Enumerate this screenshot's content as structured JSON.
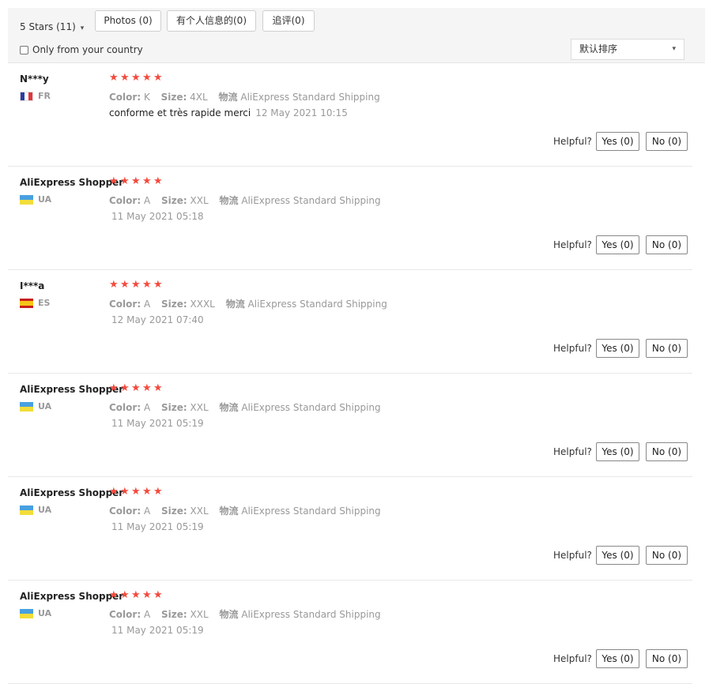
{
  "filters": {
    "star_filter": "5 Stars (11)",
    "buttons": [
      "Photos (0)",
      "有个人信息的(0)",
      "追评(0)"
    ],
    "country_label": "Only from your country",
    "sort_label": "默认排序"
  },
  "labels": {
    "color": "Color:",
    "size": "Size:",
    "shipping": "物流",
    "helpful": "Helpful?"
  },
  "reviews": [
    {
      "name": "N***y",
      "country": "FR",
      "rating": 5,
      "color": "K",
      "size": "4XL",
      "shipping": "AliExpress Standard Shipping",
      "comment": "conforme et très rapide merci",
      "date": "12 May 2021 10:15",
      "yes": "Yes (0)",
      "no": "No (0)"
    },
    {
      "name": "AliExpress Shopper",
      "country": "UA",
      "rating": 5,
      "color": "A",
      "size": "XXL",
      "shipping": "AliExpress Standard Shipping",
      "comment": "",
      "date": "11 May 2021 05:18",
      "yes": "Yes (0)",
      "no": "No (0)"
    },
    {
      "name": "I***a",
      "country": "ES",
      "rating": 5,
      "color": "A",
      "size": "XXXL",
      "shipping": "AliExpress Standard Shipping",
      "comment": "",
      "date": "12 May 2021 07:40",
      "yes": "Yes (0)",
      "no": "No (0)"
    },
    {
      "name": "AliExpress Shopper",
      "country": "UA",
      "rating": 5,
      "color": "A",
      "size": "XXL",
      "shipping": "AliExpress Standard Shipping",
      "comment": "",
      "date": "11 May 2021 05:19",
      "yes": "Yes (0)",
      "no": "No (0)"
    },
    {
      "name": "AliExpress Shopper",
      "country": "UA",
      "rating": 5,
      "color": "A",
      "size": "XXL",
      "shipping": "AliExpress Standard Shipping",
      "comment": "",
      "date": "11 May 2021 05:19",
      "yes": "Yes (0)",
      "no": "No (0)"
    },
    {
      "name": "AliExpress Shopper",
      "country": "UA",
      "rating": 5,
      "color": "A",
      "size": "XXL",
      "shipping": "AliExpress Standard Shipping",
      "comment": "",
      "date": "11 May 2021 05:19",
      "yes": "Yes (0)",
      "no": "No (0)"
    }
  ],
  "colors": {
    "star": "#f44a3c",
    "muted": "#999999"
  }
}
